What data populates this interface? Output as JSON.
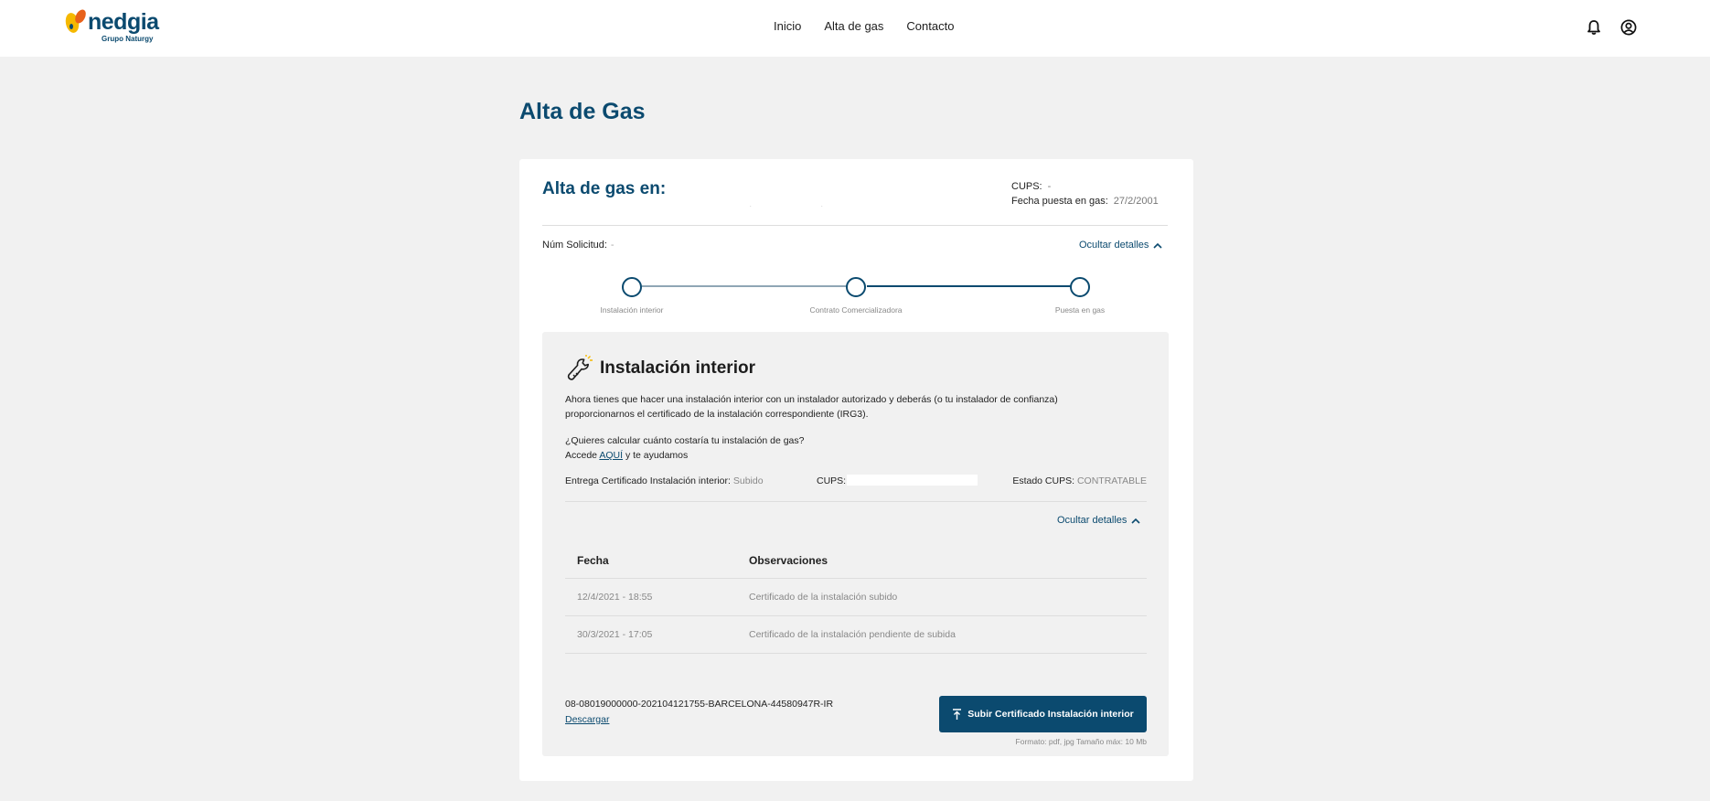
{
  "header": {
    "logo_text": "nedgia",
    "logo_subtitle": "Grupo Naturgy",
    "nav": [
      "Inicio",
      "Alta de gas",
      "Contacto"
    ]
  },
  "page": {
    "title": "Alta de Gas"
  },
  "card": {
    "title": "Alta de gas en:",
    "cups_label": "CUPS:",
    "cups_value": "-",
    "fecha_label": "Fecha puesta en gas:",
    "fecha_value": "27/2/2001",
    "num_solicitud_label": "Núm Solicitud:",
    "num_solicitud_value": "-",
    "toggle_label": "Ocultar detalles"
  },
  "steps": [
    {
      "label": "Instalación interior"
    },
    {
      "label": "Contrato Comercializadora"
    },
    {
      "label": "Puesta en gas"
    }
  ],
  "panel": {
    "title": "Instalación interior",
    "description_line1": "Ahora tienes que hacer una instalación interior con un instalador autorizado y deberás (o tu instalador de confianza)",
    "description_line2": "proporcionarnos el certificado de la instalación correspondiente (IRG3).",
    "question": "¿Quieres calcular cuánto costaría tu instalación de gas?",
    "access_prefix": "Accede",
    "access_link": "AQUÍ",
    "access_suffix": "y te ayudamos",
    "entrega_label": "Entrega Certificado Instalación interior:",
    "entrega_value": "Subido",
    "cups_label": "CUPS:",
    "estado_label": "Estado CUPS:",
    "estado_value": "CONTRATABLE",
    "toggle_label": "Ocultar detalles",
    "table": {
      "headers": [
        "Fecha",
        "Observaciones"
      ],
      "rows": [
        [
          "12/4/2021 - 18:55",
          "Certificado de la instalación subido"
        ],
        [
          "30/3/2021 - 17:05",
          "Certificado de la instalación pendiente de subida"
        ]
      ]
    },
    "filename": "08-08019000000-202104121755-BARCELONA-44580947R-IR",
    "download_label": "Descargar",
    "upload_label": "Subir Certificado Instalación interior",
    "format_note": "Formato: pdf, jpg Tamaño máx: 10 Mb"
  },
  "colors": {
    "brand": "#0b4a6f",
    "background": "#f1f1f1",
    "logo_yellow": "#f5b800",
    "logo_orange": "#e8611a"
  },
  "icons": {
    "notifications": "bell-icon",
    "account": "user-circle-icon",
    "panel": "wrench-icon",
    "upload": "upload-icon",
    "toggle": "chevron-up-icon"
  }
}
